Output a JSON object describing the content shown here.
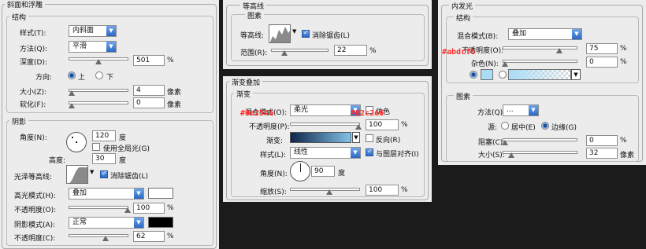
{
  "bevel": {
    "title": "斜面和浮雕",
    "structure": "结构",
    "style_label": "样式(T):",
    "style_value": "内斜面",
    "technique_label": "方法(Q):",
    "technique_value": "平滑",
    "depth_label": "深度(D):",
    "depth_value": "501",
    "depth_unit": "%",
    "direction_label": "方向:",
    "direction_up": "上",
    "direction_down": "下",
    "size_label": "大小(Z):",
    "size_value": "4",
    "size_unit": "像素",
    "soften_label": "软化(F):",
    "soften_value": "0",
    "soften_unit": "像素",
    "shading": "阴影",
    "angle_label": "角度(N):",
    "angle_value": "120",
    "angle_unit": "度",
    "global_light": "使用全局光(G)",
    "altitude_label": "高度:",
    "altitude_value": "30",
    "altitude_unit": "度",
    "gloss_label": "光泽等高线:",
    "antialias": "消除锯齿(L)",
    "highlight_label": "高光模式(H):",
    "highlight_value": "叠加",
    "highlight_color": "#ffffff",
    "hl_opacity_label": "不透明度(O):",
    "hl_opacity_value": "100",
    "hl_opacity_unit": "%",
    "shadow_label": "阴影模式(A):",
    "shadow_value": "正常",
    "shadow_color": "#000000",
    "sh_opacity_label": "不透明度(C):",
    "sh_opacity_value": "62",
    "sh_opacity_unit": "%"
  },
  "contour": {
    "title": "等高线",
    "group": "图素",
    "contour_label": "等高线:",
    "antialias": "消除锯齿(L)",
    "range_label": "范围(R):",
    "range_value": "22",
    "range_unit": "%"
  },
  "gradient": {
    "title": "渐变叠加",
    "group": "渐变",
    "blend_label": "混合模式(O):",
    "blend_value": "柔光",
    "dither": "仿色",
    "opacity_label": "不透明度(P):",
    "opacity_value": "100",
    "opacity_unit": "%",
    "gradient_label": "渐变:",
    "reverse": "反向(R)",
    "style_label": "样式(L):",
    "style_value": "线性",
    "align": "与图层对齐(I)",
    "angle_label": "角度(N):",
    "angle_value": "90",
    "angle_unit": "度",
    "scale_label": "缩放(S):",
    "scale_value": "100",
    "scale_unit": "%",
    "color_start": "#0e254b",
    "color_end": "#82c2e6",
    "hex1": "#0e254b",
    "hex2": "#82c2e6"
  },
  "inner_glow": {
    "title": "内发光",
    "structure": "结构",
    "blend_label": "混合模式(B):",
    "blend_value": "叠加",
    "opacity_label": "不透明度(O):",
    "opacity_value": "75",
    "opacity_unit": "%",
    "noise_label": "杂色(N):",
    "noise_value": "0",
    "noise_unit": "%",
    "hex": "#abdcf6",
    "color": "#abdcf6",
    "elements": "图素",
    "technique_label": "方法(Q):",
    "technique_value": "...",
    "source_label": "源:",
    "source_center": "居中(E)",
    "source_edge": "边缘(G)",
    "choke_label": "阻塞(C):",
    "choke_value": "0",
    "choke_unit": "%",
    "size_label": "大小(S):",
    "size_value": "32",
    "size_unit": "像素"
  }
}
